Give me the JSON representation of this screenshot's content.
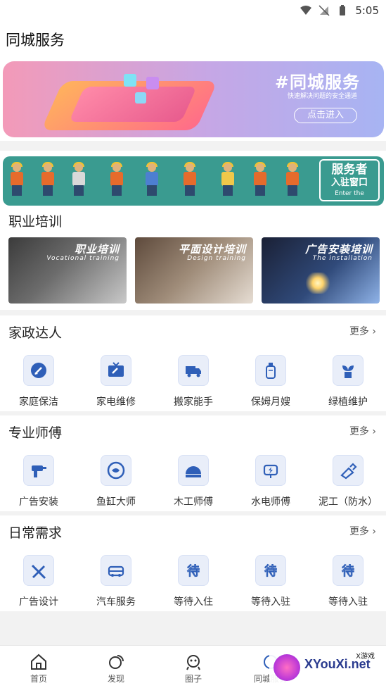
{
  "status_bar": {
    "time": "5:05"
  },
  "header": {
    "title": "同城服务"
  },
  "hero_banner": {
    "title": "#同城服务",
    "subtitle": "快速解决问题的安全通道",
    "cta": "点击进入"
  },
  "worker_banner": {
    "line1": "服务者",
    "line2": "入驻窗口",
    "line3": "Enter the"
  },
  "training": {
    "heading": "职业培训",
    "cards": [
      {
        "title": "职业培训",
        "subtitle": "Vocational training"
      },
      {
        "title": "平面设计培训",
        "subtitle": "Design training"
      },
      {
        "title": "广告安装培训",
        "subtitle": "The installation"
      }
    ]
  },
  "sections": [
    {
      "heading": "家政达人",
      "more": "更多",
      "items": [
        {
          "label": "家庭保洁",
          "icon": "broom-icon"
        },
        {
          "label": "家电维修",
          "icon": "tv-repair-icon"
        },
        {
          "label": "搬家能手",
          "icon": "truck-icon"
        },
        {
          "label": "保姆月嫂",
          "icon": "bottle-icon"
        },
        {
          "label": "绿植维护",
          "icon": "plant-icon"
        }
      ]
    },
    {
      "heading": "专业师傅",
      "more": "更多",
      "items": [
        {
          "label": "广告安装",
          "icon": "drill-icon"
        },
        {
          "label": "鱼缸大师",
          "icon": "fish-tank-icon"
        },
        {
          "label": "木工师傅",
          "icon": "saw-icon"
        },
        {
          "label": "水电师傅",
          "icon": "plug-icon"
        },
        {
          "label": "泥工（防水）",
          "icon": "trowel-icon"
        }
      ]
    },
    {
      "heading": "日常需求",
      "more": "更多",
      "items": [
        {
          "label": "广告设计",
          "icon": "design-tools-icon"
        },
        {
          "label": "汽车服务",
          "icon": "car-icon"
        },
        {
          "label": "等待入住",
          "icon": "wait-icon"
        },
        {
          "label": "等待入驻",
          "icon": "wait-icon"
        },
        {
          "label": "等待入驻",
          "icon": "wait-icon"
        }
      ]
    }
  ],
  "bottom_nav": [
    {
      "label": "首页",
      "icon": "home-icon"
    },
    {
      "label": "发现",
      "icon": "discover-icon"
    },
    {
      "label": "圈子",
      "icon": "community-icon"
    },
    {
      "label": "同城服务",
      "icon": "local-service-icon"
    }
  ],
  "watermark": {
    "text": "XYouXi.net",
    "small": "X游戏"
  },
  "colors": {
    "icon_blue": "#2f5fb8",
    "icon_bg": "#e9eef9",
    "worker_banner": "#3a9b90"
  }
}
